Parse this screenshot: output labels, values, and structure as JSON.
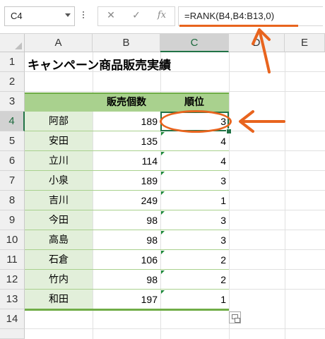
{
  "name_box": {
    "value": "C4"
  },
  "formula_bar": {
    "cancel_symbol": "✕",
    "enter_symbol": "✓",
    "function_symbol": "fx",
    "formula": "=RANK(B4,B4:B13,0)"
  },
  "columns": [
    "A",
    "B",
    "C",
    "D",
    "E"
  ],
  "rows": [
    "1",
    "2",
    "3",
    "4",
    "5",
    "6",
    "7",
    "8",
    "9",
    "10",
    "11",
    "12",
    "13",
    "14"
  ],
  "selected_cell": {
    "column": "C",
    "row": "4"
  },
  "sheet": {
    "title": "キャンペーン商品販売実績",
    "headers": {
      "a": "",
      "b": "販売個数",
      "c": "順位"
    },
    "data": [
      {
        "name": "阿部",
        "qty": "189",
        "rank": "3"
      },
      {
        "name": "安田",
        "qty": "135",
        "rank": "4"
      },
      {
        "name": "立川",
        "qty": "114",
        "rank": "4"
      },
      {
        "name": "小泉",
        "qty": "189",
        "rank": "3"
      },
      {
        "name": "吉川",
        "qty": "249",
        "rank": "1"
      },
      {
        "name": "今田",
        "qty": "98",
        "rank": "3"
      },
      {
        "name": "高島",
        "qty": "98",
        "rank": "3"
      },
      {
        "name": "石倉",
        "qty": "106",
        "rank": "2"
      },
      {
        "name": "竹内",
        "qty": "98",
        "rank": "2"
      },
      {
        "name": "和田",
        "qty": "197",
        "rank": "1"
      }
    ]
  },
  "colors": {
    "annotation": "#e8641e",
    "header_fill": "#a9d18e",
    "name_fill": "#e2efda",
    "accent_border": "#70ad47",
    "selection": "#217346"
  },
  "icons": [
    "chevron-down-icon",
    "cancel-icon",
    "enter-icon",
    "function-icon",
    "quick-analysis-icon",
    "arrow-left-icon",
    "arrow-up-icon"
  ]
}
